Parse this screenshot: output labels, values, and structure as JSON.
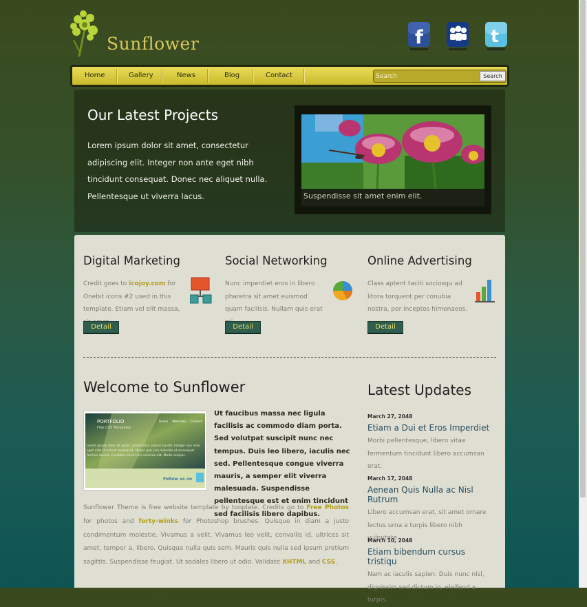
{
  "brand": {
    "name": "Sunflower"
  },
  "social": [
    "facebook-icon",
    "myspace-icon",
    "twitter-icon"
  ],
  "nav": {
    "items": [
      "Home",
      "Gallery",
      "News",
      "Blog",
      "Contact"
    ],
    "search_placeholder": "Search",
    "search_button": "Search"
  },
  "hero": {
    "title": "Our Latest Projects",
    "text": "Lorem ipsum dolor sit amet, consectetur adipiscing elit. Integer non ante eget nibh tincidunt consequat. Donec nec aliquet nulla. Pellentesque ut viverra lacus.",
    "caption": "Suspendisse sit amet enim elit."
  },
  "services": [
    {
      "title": "Digital Marketing",
      "text_pre": "Credit goes to ",
      "link": "icojoy.com",
      "text_post": " for Onebit icons #2 used in this template. Etiam vel elit massa, sit amet.",
      "button": "Detail",
      "icon": "network-icon"
    },
    {
      "title": "Social Networking",
      "text_pre": "Nunc imperdiet eros in libero pharetra sit amet euismod quam facilisis. Nullam quis erat mi.",
      "link": "",
      "text_post": "",
      "button": "Detail",
      "icon": "pie-chart-icon"
    },
    {
      "title": "Online Advertising",
      "text_pre": "Class aptent taciti sociosqu ad litora torquent per conubia nostra, per inceptos himenaeos.",
      "link": "",
      "text_post": "",
      "button": "Detail",
      "icon": "bar-chart-icon"
    }
  ],
  "welcome": {
    "title": "Welcome to Sunflower",
    "bold_text": "Ut faucibus massa nec ligula facilisis ac commodo diam porta. Sed volutpat suscipit nunc nec tempus. Duis leo libero, iaculis nec sed. Pellentesque congue viverra mauris, a semper elit viverra malesuada. Suspendisse pellentesque est et enim tincidunt sed facilisis libero dapibus.",
    "body_1": "Sunflower Theme is free website template by tooplate. Credits go to ",
    "link_1": "Free Photos",
    "body_2": " for photos and ",
    "link_2": "forty-winks",
    "body_3": " for Photoshop brushes. Quisque in diam a justo condimentum molestie. Vivamus a velit. Vivamus leo velit, convallis id, ultrices sit amet, tempor a, libero. Quisque nulla quis sem. Mauris quis nulla sed ipsum pretium sagittis. Suspendisse feugiat. Ut sodales libero ut odio. Validate ",
    "link_3": "XHTML",
    "body_4": " and ",
    "link_4": "CSS",
    "body_5": ".",
    "thumb": {
      "title": "PORTFOLIO",
      "sub": "Free CSS Templates",
      "menu": [
        "Home",
        "Websites",
        "Contact"
      ],
      "text": "Lorem ipsum dolor sit amet, consectetur adipiscing elit. Integer non ante eget nibh tincidunt consequat. Donec quis nisl molestie ut consequat facilisis lacinia. Curabitur lorem nisi vehicula elit. Morbi semper.",
      "follow": "Follow us on"
    }
  },
  "updates": {
    "title": "Latest Updates",
    "items": [
      {
        "date": "March 27, 2048",
        "title": "Etiam a Dui et Eros Imperdiet",
        "text": "Morbi pellentesque, libero vitae fermentum tincidunt libero accumsan erat."
      },
      {
        "date": "March 17, 2048",
        "title": "Aenean Quis Nulla ac Nisl Rutrum",
        "text": "Libero accumsan erat, sit amet ornare lectus urna a turpis libero nibh vulputate."
      },
      {
        "date": "March 10, 2048",
        "title": "Etiam bibendum cursus tristiqu",
        "text": "Nam ac iaculis sapien. Duis nunc nisl, dignissim sed dictum in, eleifend a turpis."
      }
    ]
  }
}
